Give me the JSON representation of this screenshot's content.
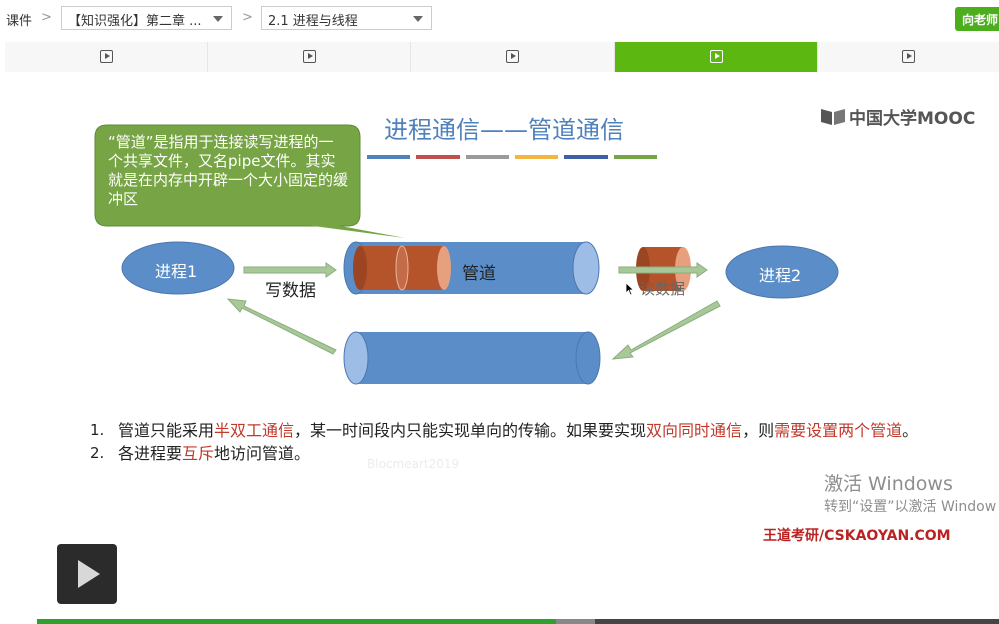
{
  "breadcrumb": {
    "root": "课件",
    "chapter_select": "【知识强化】第二章 ...",
    "lesson_select": "2.1 进程与线程"
  },
  "ask_button": "向老师",
  "tabs": [
    {
      "icon": "video-icon",
      "active": false
    },
    {
      "icon": "video-icon",
      "active": false
    },
    {
      "icon": "video-icon",
      "active": false
    },
    {
      "icon": "video-icon",
      "active": true
    },
    {
      "icon": "video-icon",
      "active": false
    }
  ],
  "slide": {
    "title": "进程通信——管道通信",
    "title_bar_colors": [
      "#4f81bd",
      "#c0504d",
      "#9b9b9b",
      "#f4b642",
      "#3f5fa8",
      "#77a545"
    ],
    "logo_text": "中国大学MOOC",
    "callout": "“管道”是指用于连接读写进程的一个共享文件，又名pipe文件。其实就是在内存中开辟一个大小固定的缓冲区",
    "process1": "进程1",
    "process2": "进程2",
    "pipe_label": "管道",
    "write_label": "写数据",
    "read_label": "读数据",
    "mid_watermark": "Blocmeart2019",
    "notes": [
      {
        "num": "1.",
        "parts": [
          {
            "t": "管道只能采用",
            "red": false
          },
          {
            "t": "半双工通信",
            "red": true
          },
          {
            "t": "，某一时间段内只能实现单向的传输。如果要实现",
            "red": false
          },
          {
            "t": "双向同时通信",
            "red": true
          },
          {
            "t": "，则",
            "red": false
          },
          {
            "t": "需要设置两个管道",
            "red": true
          },
          {
            "t": "。",
            "red": false
          }
        ]
      },
      {
        "num": "2.",
        "parts": [
          {
            "t": "各进程要",
            "red": false
          },
          {
            "t": "互斥",
            "red": true
          },
          {
            "t": "地访问管道。",
            "red": false
          }
        ]
      }
    ]
  },
  "windows_activation": {
    "line1": "激活 Windows",
    "line2": "转到“设置”以激活 Window"
  },
  "brand": "王道考研/CSKAOYAN.COM",
  "player": {
    "played_fraction": 0.54,
    "buffered_fraction": 0.58
  },
  "colors": {
    "accent_green": "#5cb811",
    "diagram_blue": "#5b8ec9",
    "callout_green": "#77a545",
    "cylinder_rust": "#b5532a",
    "arrow_green": "#a9c89a",
    "emphasis_red": "#c0392b"
  }
}
